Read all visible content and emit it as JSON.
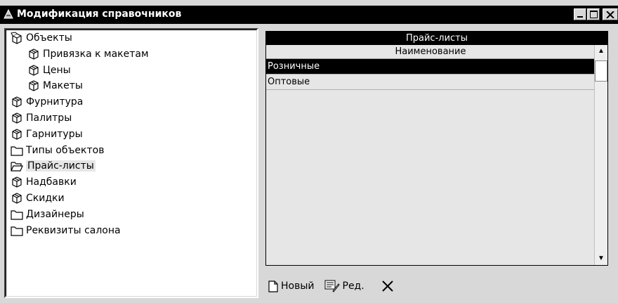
{
  "window": {
    "title": "Модификация справочников"
  },
  "tree": {
    "items": [
      {
        "label": "Объекты",
        "icon": "cube-open-icon",
        "level": 0
      },
      {
        "label": "Привязка к макетам",
        "icon": "cube-icon",
        "level": 1
      },
      {
        "label": "Цены",
        "icon": "cube-icon",
        "level": 1
      },
      {
        "label": "Макеты",
        "icon": "cube-icon",
        "level": 1
      },
      {
        "label": "Фурнитура",
        "icon": "cube-icon",
        "level": 0
      },
      {
        "label": "Палитры",
        "icon": "cube-icon",
        "level": 0
      },
      {
        "label": "Гарнитуры",
        "icon": "cube-icon",
        "level": 0
      },
      {
        "label": "Типы объектов",
        "icon": "folder-icon",
        "level": 0
      },
      {
        "label": "Прайс-листы",
        "icon": "folder-open-icon",
        "level": 0,
        "selected": true
      },
      {
        "label": "Надбавки",
        "icon": "cube-icon",
        "level": 0
      },
      {
        "label": "Скидки",
        "icon": "cube-icon",
        "level": 0
      },
      {
        "label": "Дизайнеры",
        "icon": "folder-icon",
        "level": 0
      },
      {
        "label": "Реквизиты салона",
        "icon": "folder-icon",
        "level": 0
      }
    ]
  },
  "grid": {
    "title": "Прайс-листы",
    "column": "Наименование",
    "rows": [
      {
        "name": "Розничные",
        "selected": true
      },
      {
        "name": "Оптовые",
        "selected": false
      }
    ]
  },
  "toolbar": {
    "new_label": "Новый",
    "edit_label": "Ред."
  }
}
